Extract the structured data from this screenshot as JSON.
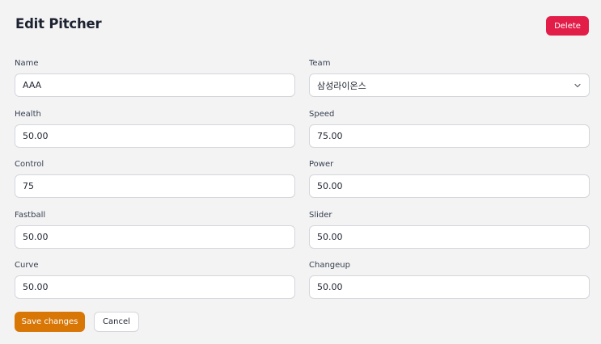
{
  "header": {
    "title": "Edit Pitcher",
    "delete_label": "Delete"
  },
  "form": {
    "name": {
      "label": "Name",
      "value": "AAA"
    },
    "team": {
      "label": "Team",
      "value": "삼성라이온스"
    },
    "health": {
      "label": "Health",
      "value": "50.00"
    },
    "speed": {
      "label": "Speed",
      "value": "75.00"
    },
    "control": {
      "label": "Control",
      "value": "75"
    },
    "power": {
      "label": "Power",
      "value": "50.00"
    },
    "fastball": {
      "label": "Fastball",
      "value": "50.00"
    },
    "slider": {
      "label": "Slider",
      "value": "50.00"
    },
    "curve": {
      "label": "Curve",
      "value": "50.00"
    },
    "changeup": {
      "label": "Changeup",
      "value": "50.00"
    }
  },
  "actions": {
    "save_label": "Save changes",
    "cancel_label": "Cancel"
  },
  "colors": {
    "delete_button": "#e11d48",
    "save_button": "#d97706",
    "background": "#f3f3f4"
  },
  "icons": {
    "team_select": "chevron-down-icon"
  }
}
